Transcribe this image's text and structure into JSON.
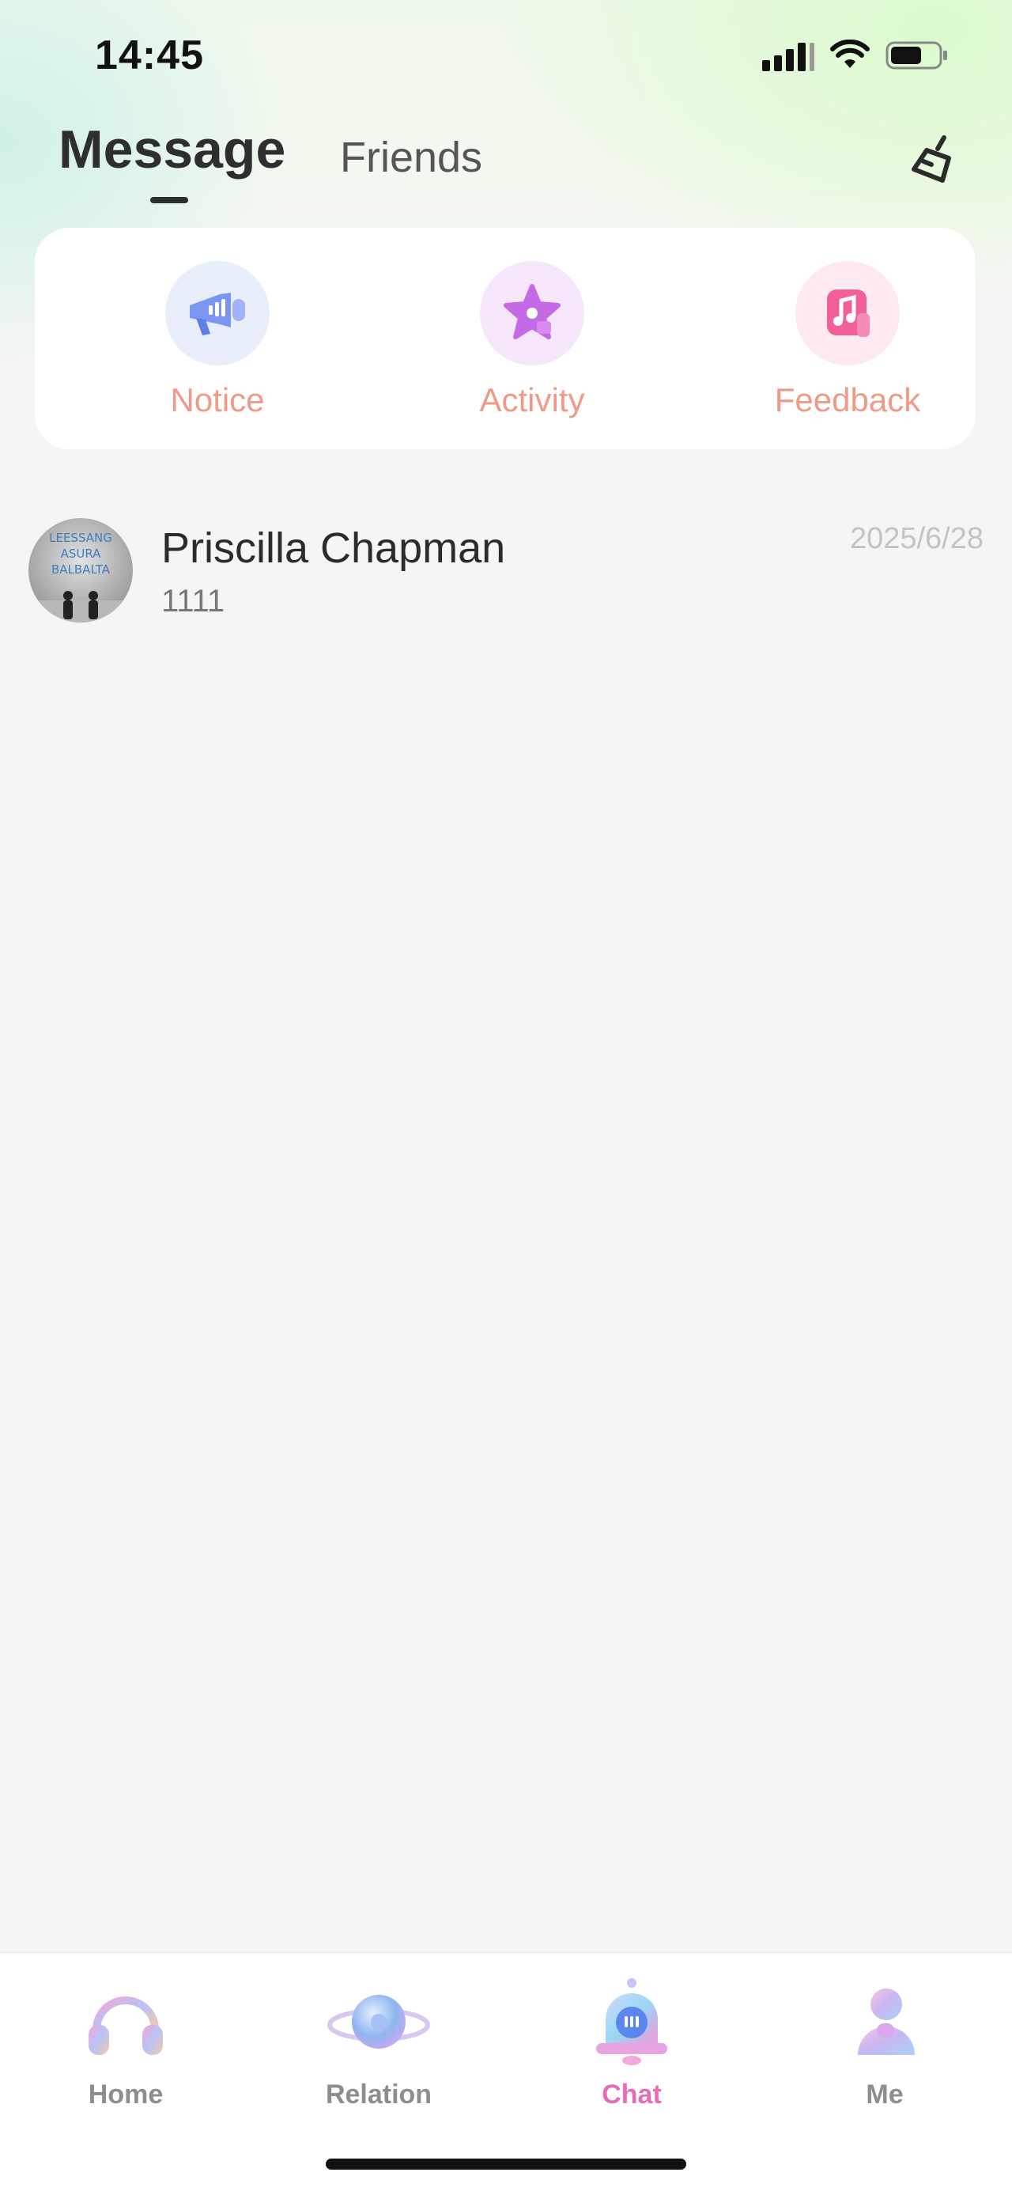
{
  "status_bar": {
    "time": "14:45"
  },
  "header": {
    "tabs": [
      {
        "label": "Message",
        "active": true
      },
      {
        "label": "Friends",
        "active": false
      }
    ],
    "clean_icon": "broom-icon"
  },
  "shortcuts": [
    {
      "label": "Notice",
      "icon": "megaphone-icon",
      "color": "#6f8ef0"
    },
    {
      "label": "Activity",
      "icon": "star-icon",
      "color": "#c56ae6"
    },
    {
      "label": "Feedback",
      "icon": "music-note-icon",
      "color": "#f2609a"
    }
  ],
  "conversations": [
    {
      "name": "Priscilla Chapman",
      "preview": "1111",
      "date": "2025/6/28",
      "avatar_text": [
        "LEESSANG",
        "ASURA",
        "BALBALTA"
      ]
    }
  ],
  "bottom_nav": {
    "items": [
      {
        "label": "Home",
        "icon": "headphones-icon",
        "active": false
      },
      {
        "label": "Relation",
        "icon": "planet-icon",
        "active": false
      },
      {
        "label": "Chat",
        "icon": "bell-chat-icon",
        "active": true
      },
      {
        "label": "Me",
        "icon": "person-icon",
        "active": false
      }
    ],
    "active_color": "#e86bb6"
  }
}
